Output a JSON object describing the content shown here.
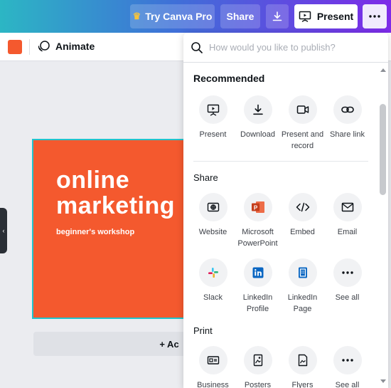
{
  "header": {
    "try_pro_label": "Try Canva Pro",
    "share_label": "Share",
    "present_label": "Present",
    "colors": {
      "gradient_start": "#2cb6c4",
      "gradient_end": "#7d2ae8"
    }
  },
  "toolbar": {
    "swatch_color": "#f4592e",
    "animate_label": "Animate"
  },
  "design": {
    "background": "#f4592e",
    "title_line1": "online",
    "title_line2": "marketing",
    "subtitle": "beginner's workshop",
    "add_page_label": "+ Ac"
  },
  "publish": {
    "search_placeholder": "How would you like to publish?",
    "recommended": {
      "title": "Recommended",
      "items": [
        {
          "label": "Present",
          "icon": "present-icon"
        },
        {
          "label": "Download",
          "icon": "download-icon"
        },
        {
          "label": "Present and record",
          "icon": "video-record-icon"
        },
        {
          "label": "Share link",
          "icon": "link-icon"
        }
      ]
    },
    "share": {
      "title": "Share",
      "items": [
        {
          "label": "Website",
          "icon": "website-icon"
        },
        {
          "label": "Microsoft PowerPoint",
          "icon": "powerpoint-icon"
        },
        {
          "label": "Embed",
          "icon": "embed-icon"
        },
        {
          "label": "Email",
          "icon": "email-icon"
        },
        {
          "label": "Slack",
          "icon": "slack-icon"
        },
        {
          "label": "LinkedIn Profile",
          "icon": "linkedin-icon"
        },
        {
          "label": "LinkedIn Page",
          "icon": "linkedin-page-icon"
        },
        {
          "label": "See all",
          "icon": "more-icon"
        }
      ]
    },
    "print": {
      "title": "Print",
      "items": [
        {
          "label": "Business",
          "icon": "business-card-icon"
        },
        {
          "label": "Posters",
          "icon": "poster-icon"
        },
        {
          "label": "Flyers",
          "icon": "flyer-icon"
        },
        {
          "label": "See all",
          "icon": "more-icon"
        }
      ]
    }
  }
}
